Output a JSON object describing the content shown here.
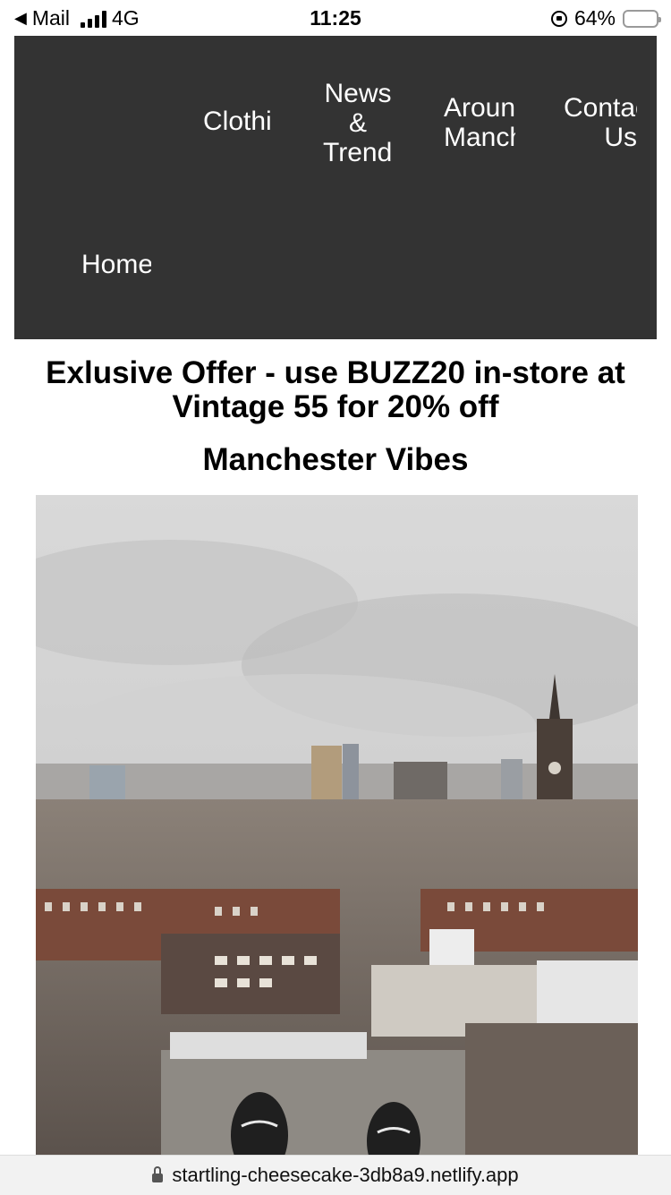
{
  "status_bar": {
    "back_app": "Mail",
    "network": "4G",
    "time": "11:25",
    "battery": "64%",
    "battery_level": 0.64,
    "battery_color": "#f4c430"
  },
  "nav": {
    "background": "#333333",
    "items": [
      {
        "label": "Clothing"
      },
      {
        "label": "News & Trends"
      },
      {
        "label": "Around Manchester"
      },
      {
        "label": "Contact Us"
      },
      {
        "label": "Home"
      }
    ]
  },
  "offer_text": "Exlusive Offer - use BUZZ20 in-store at Vintage 55 for 20% off",
  "section_title": "Manchester Vibes",
  "photo": {
    "alt": "Manchester skyline from rooftop"
  },
  "url": "startling-cheesecake-3db8a9.netlify.app",
  "icons": [
    "back-arrow-icon",
    "signal-icon",
    "rotation-lock-icon",
    "battery-icon",
    "padlock-icon"
  ]
}
